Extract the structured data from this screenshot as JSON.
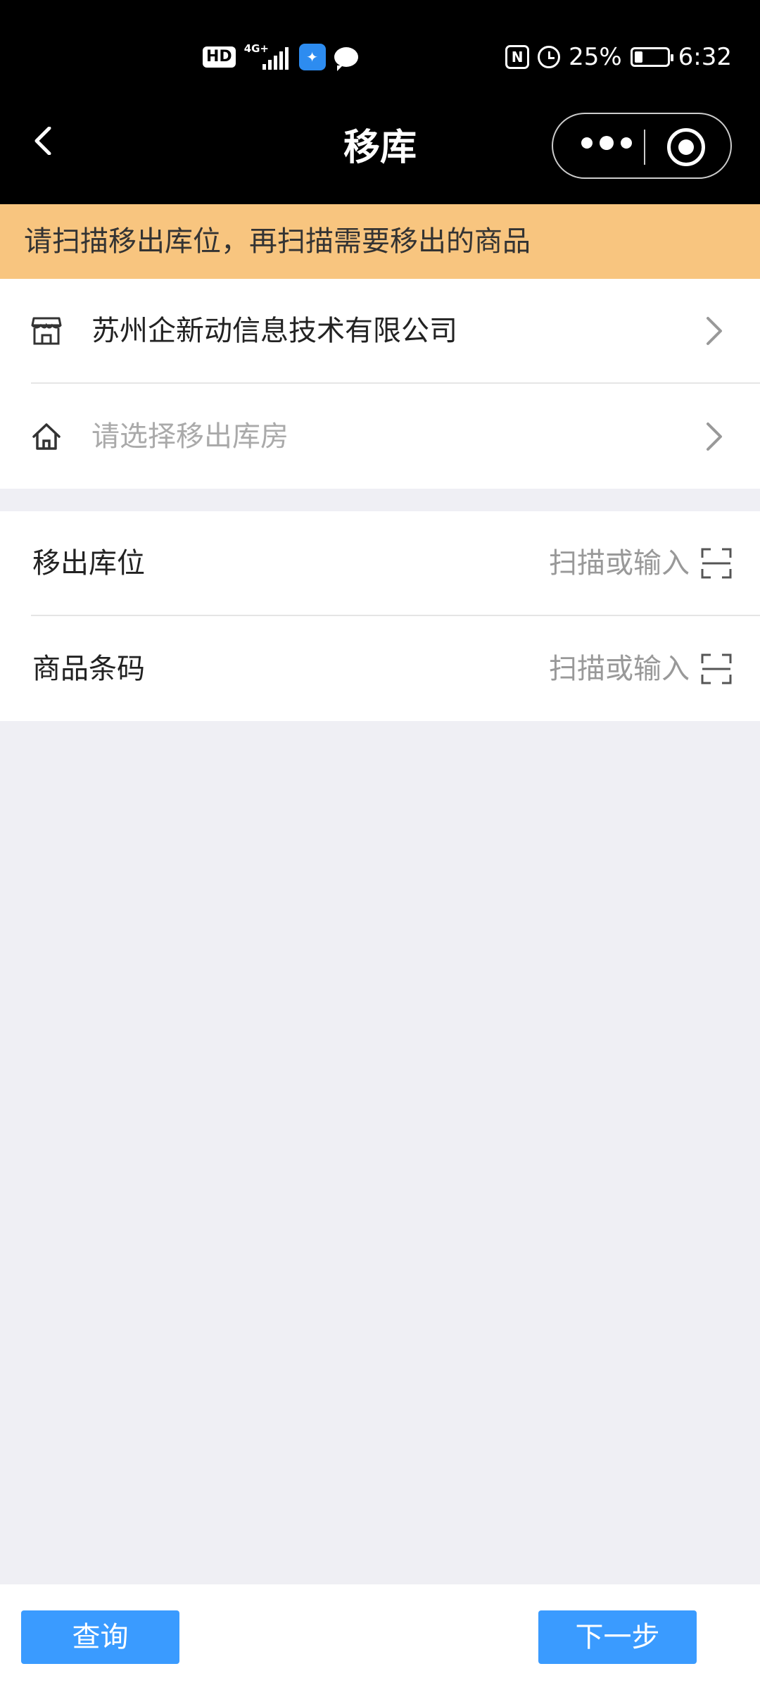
{
  "status_bar": {
    "hd": "HD",
    "network": "4G+",
    "battery_pct": "25%",
    "battery_level": 0.25,
    "time": "6:32",
    "nfc": "N"
  },
  "nav": {
    "title": "移库"
  },
  "notice": "请扫描移出库位，再扫描需要移出的商品",
  "company": {
    "name": "苏州企新动信息技术有限公司"
  },
  "warehouse": {
    "placeholder": "请选择移出库房"
  },
  "fields": [
    {
      "label": "移出库位",
      "placeholder": "扫描或输入"
    },
    {
      "label": "商品条码",
      "placeholder": "扫描或输入"
    }
  ],
  "buttons": {
    "query": "查询",
    "next": "下一步"
  },
  "colors": {
    "notice_bg": "#f8c57f",
    "primary": "#3a9bff",
    "page_bg": "#efeff4"
  }
}
